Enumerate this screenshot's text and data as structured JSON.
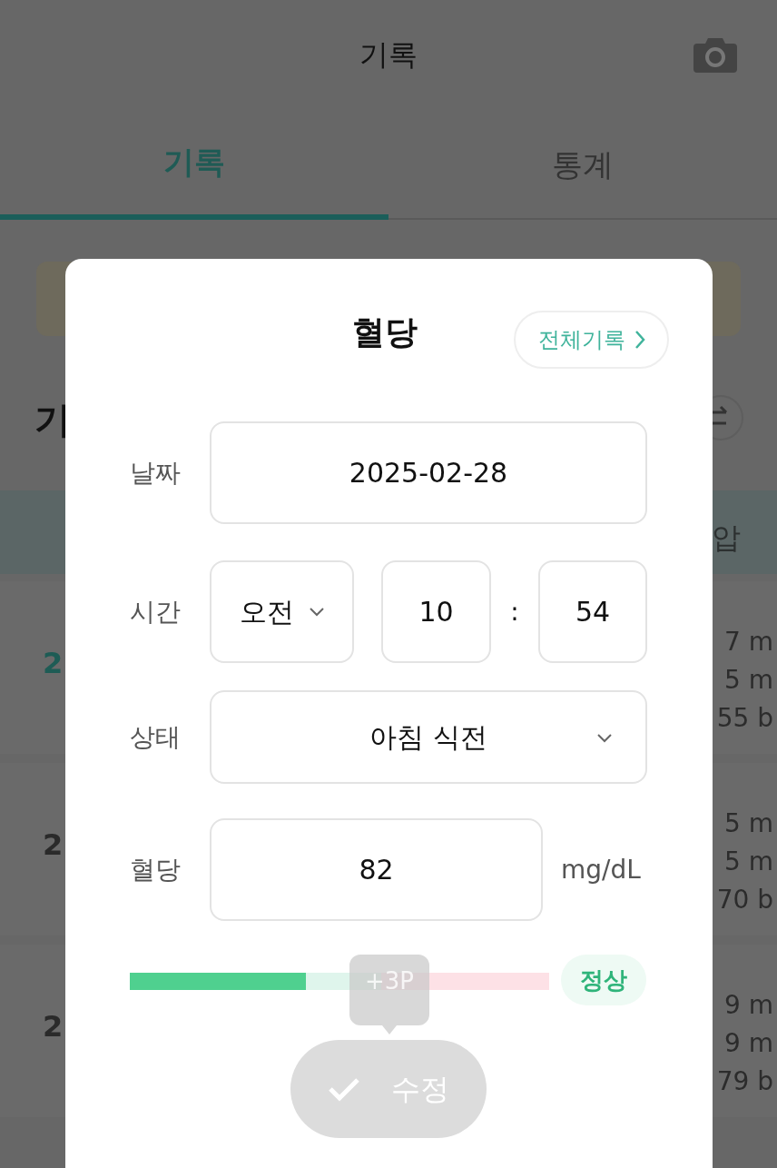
{
  "app_bar": {
    "title": "기록"
  },
  "tabs": [
    {
      "label": "기록",
      "selected": true
    },
    {
      "label": "통계",
      "selected": false
    }
  ],
  "background": {
    "heading": "기",
    "column_header": "압",
    "rows": [
      {
        "date": "2",
        "selected": true,
        "values": [
          "7 m",
          "5 m",
          "55 b"
        ]
      },
      {
        "date": "2",
        "selected": false,
        "values": [
          "5 m",
          "5 m",
          "70 b"
        ]
      },
      {
        "date": "2",
        "selected": false,
        "values": [
          "9 m",
          "9 m",
          "79 b"
        ]
      }
    ]
  },
  "dialog": {
    "title": "혈당",
    "all_records_button": "전체기록",
    "date": {
      "label": "날짜",
      "value": "2025-02-28"
    },
    "time": {
      "label": "시간",
      "period": "오전",
      "hour": "10",
      "separator": ":",
      "minute": "54"
    },
    "state": {
      "label": "상태",
      "value": "아침 식전"
    },
    "glucose": {
      "label": "혈당",
      "value": "82",
      "unit": "mg/dL"
    },
    "gauge": {
      "level": 0.42
    },
    "status_badge": "정상",
    "points_tooltip": "+3P",
    "save_button": {
      "label": "수정",
      "disabled": true
    }
  }
}
